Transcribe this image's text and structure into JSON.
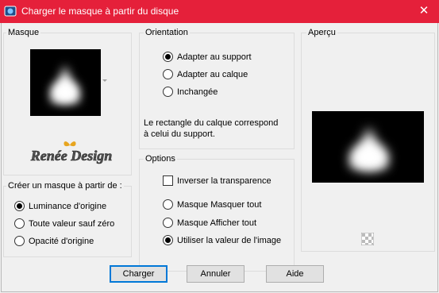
{
  "window": {
    "title": "Charger le masque à partir du disque",
    "close_glyph": "✕"
  },
  "masque": {
    "label": "Masque",
    "logo_text": "Renée Design"
  },
  "create": {
    "label": "Créer un masque à partir de :",
    "options": [
      {
        "label": "Luminance d'origine",
        "checked": true
      },
      {
        "label": "Toute valeur sauf zéro",
        "checked": false
      },
      {
        "label": "Opacité d'origine",
        "checked": false
      }
    ]
  },
  "orientation": {
    "label": "Orientation",
    "options": [
      {
        "label": "Adapter au support",
        "checked": true
      },
      {
        "label": "Adapter au calque",
        "checked": false
      },
      {
        "label": "Inchangée",
        "checked": false
      }
    ],
    "note_line1": "Le rectangle du calque correspond",
    "note_line2": "à celui du support."
  },
  "options": {
    "label": "Options",
    "invert_label": "Inverser la transparence",
    "invert_checked": false,
    "radios": [
      {
        "label": "Masque Masquer tout",
        "checked": false
      },
      {
        "label": "Masque Afficher tout",
        "checked": false
      },
      {
        "label": "Utiliser la valeur de l'image",
        "checked": true
      }
    ]
  },
  "apercu": {
    "label": "Aperçu"
  },
  "buttons": {
    "load": "Charger",
    "cancel": "Annuler",
    "help": "Aide"
  }
}
